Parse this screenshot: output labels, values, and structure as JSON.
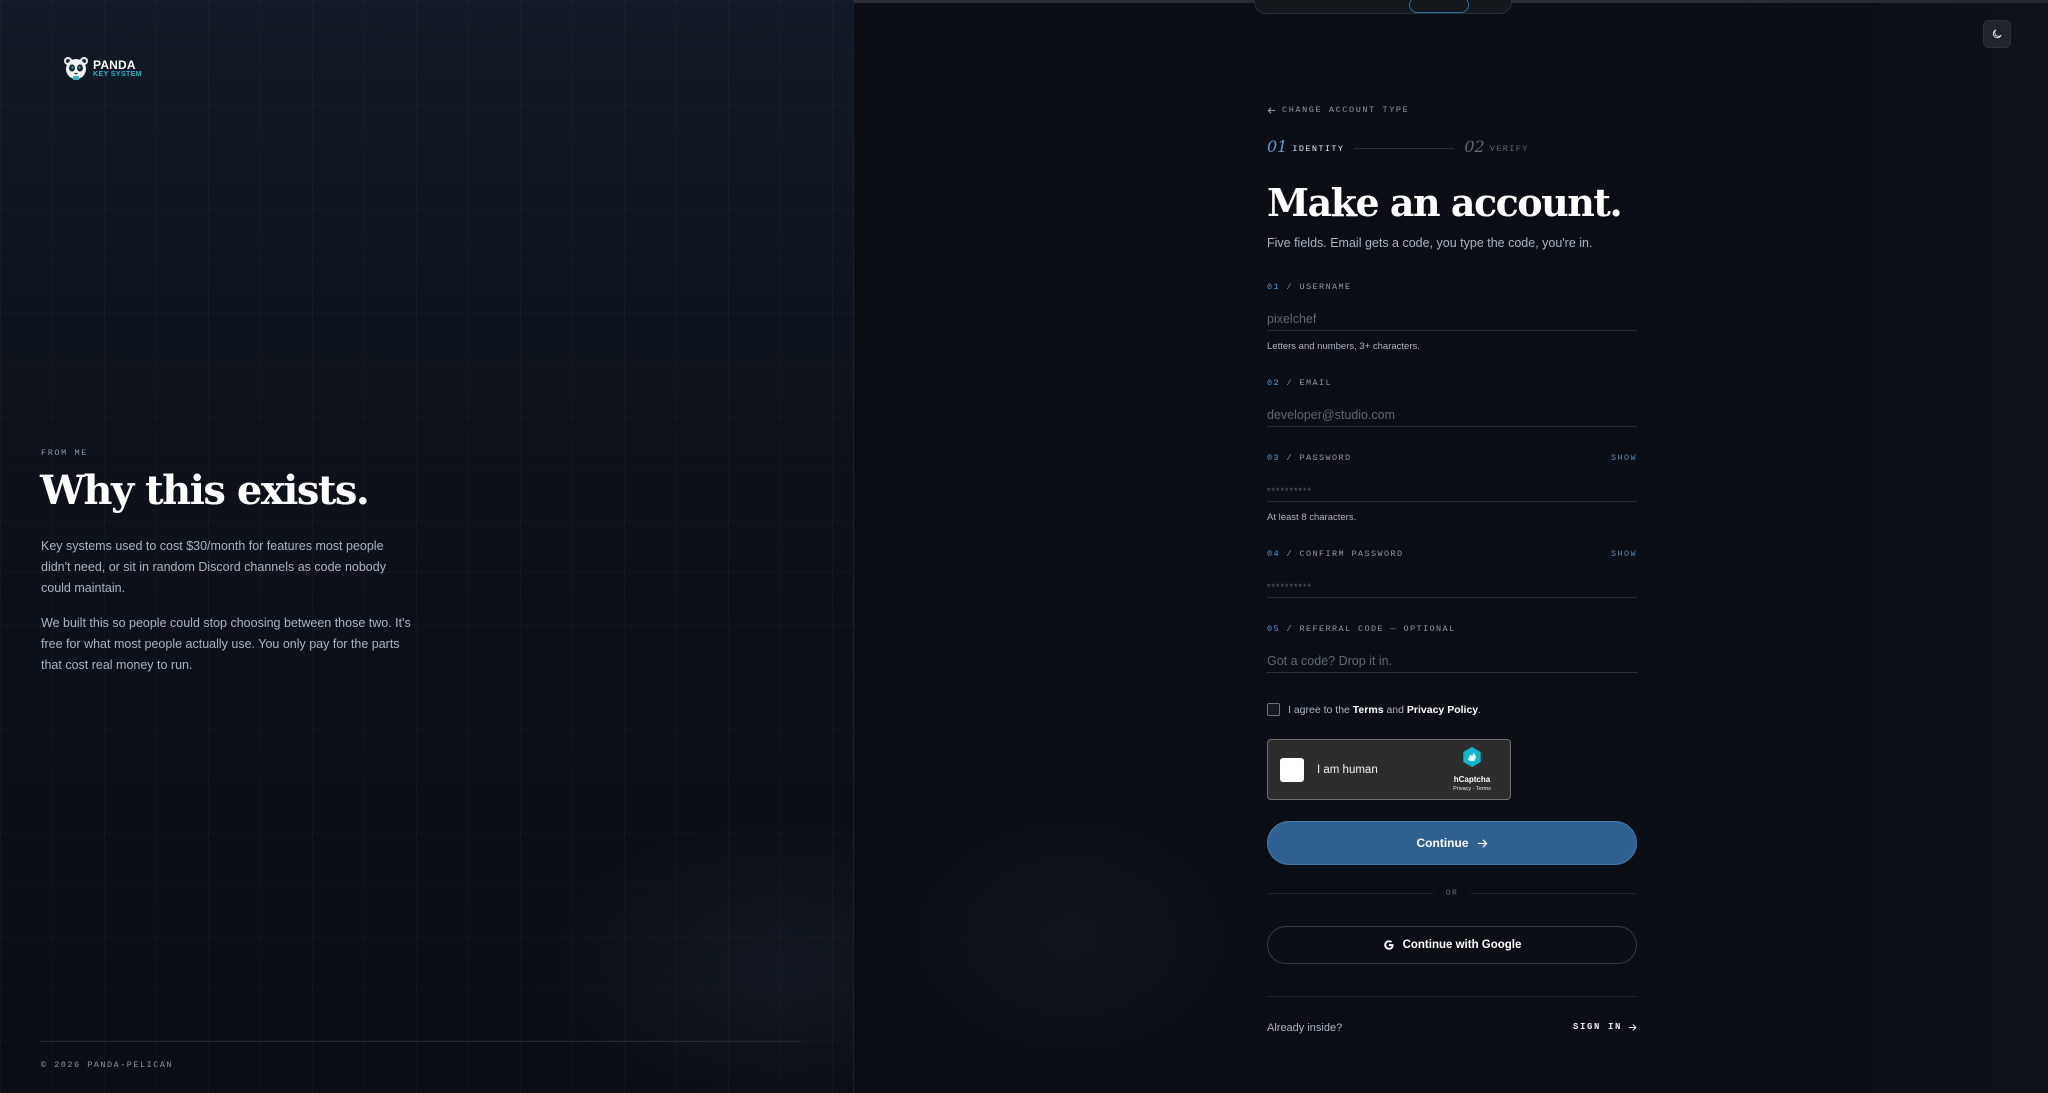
{
  "brand": {
    "name_line1": "PANDA",
    "name_line2": "KEY SYSTEM",
    "icon": "panda-logo-icon"
  },
  "left": {
    "eyebrow": "FROM ME",
    "title": "Why this exists.",
    "paragraph1": "Key systems used to cost $30/month for features most people didn't need, or sit in random Discord channels as code nobody could maintain.",
    "paragraph2": "We built this so people could stop choosing between those two. It's free for what most people actually use. You only pay for the parts that cost real money to run.",
    "copyright": "© 2026 PANDA-PELICAN"
  },
  "theme_toggle": {
    "icon": "moon-icon"
  },
  "form": {
    "back_link": "CHANGE ACCOUNT TYPE",
    "steps": [
      {
        "num": "01",
        "label": "IDENTITY",
        "active": true
      },
      {
        "num": "02",
        "label": "VERIFY",
        "active": false
      }
    ],
    "title": "Make an account.",
    "subtitle": "Five fields. Email gets a code, you type the code, you're in.",
    "fields": [
      {
        "num": "01",
        "sep": " / ",
        "label": "USERNAME",
        "placeholder": "pixelchef",
        "hint": "Letters and numbers, 3+ characters."
      },
      {
        "num": "02",
        "sep": " / ",
        "label": "EMAIL",
        "placeholder": "developer@studio.com"
      },
      {
        "num": "03",
        "sep": " / ",
        "label": "PASSWORD",
        "placeholder": "**********",
        "show": "SHOW",
        "hint": "At least 8 characters."
      },
      {
        "num": "04",
        "sep": " / ",
        "label": "CONFIRM PASSWORD",
        "placeholder": "**********",
        "show": "SHOW"
      },
      {
        "num": "05",
        "sep": " / ",
        "label": "REFERRAL CODE — OPTIONAL",
        "placeholder": "Got a code? Drop it in."
      }
    ],
    "agree": {
      "prefix": "I agree to the ",
      "terms": "Terms",
      "and": " and ",
      "privacy": "Privacy Policy",
      "suffix": "."
    },
    "captcha": {
      "label": "I am human",
      "brand": "hCaptcha",
      "links": "Privacy - Terms"
    },
    "continue_label": "Continue",
    "or_label": "OR",
    "google_label": "Continue with Google",
    "already_label": "Already inside?",
    "signin_label": "SIGN IN"
  },
  "colors": {
    "background": "#0b0e14",
    "accent": "#5b9bd5",
    "primary_button": "#2f6190"
  }
}
